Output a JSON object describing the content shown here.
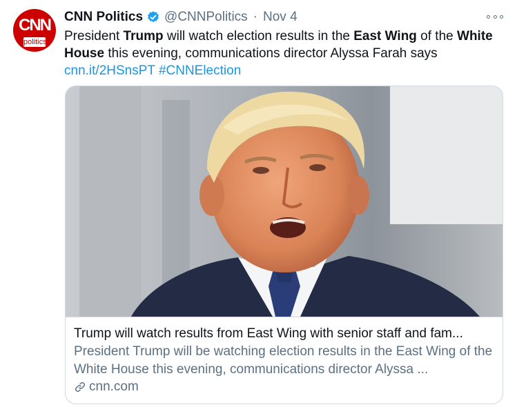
{
  "account": {
    "avatar_logo": "CNN",
    "avatar_sub": "politics",
    "name": "CNN Politics",
    "handle": "@CNNPolitics",
    "separator": "·",
    "date": "Nov 4"
  },
  "tweet": {
    "t1": "President ",
    "b1": "Trump",
    "t2": " will watch election results in the ",
    "b2": "East Wing",
    "t3": " of the ",
    "b3": "White House",
    "t4": " this evening, communications director Alyssa Farah says",
    "link": "cnn.it/2HSnsPT",
    "hashtag": "#CNNElection"
  },
  "card": {
    "title": "Trump will watch results from East Wing with senior staff and fam...",
    "description": "President Trump will be watching election results in the East Wing of the White House this evening, communications director Alyssa ...",
    "domain": "cnn.com",
    "domain_icon": "link-icon"
  },
  "icons": {
    "verified": "verified-badge-icon",
    "more": "more-options-icon"
  },
  "colors": {
    "brand_red": "#cc0000",
    "link_blue": "#1b95e0",
    "verified_blue": "#1da1f2",
    "secondary_text": "#5b7083"
  }
}
